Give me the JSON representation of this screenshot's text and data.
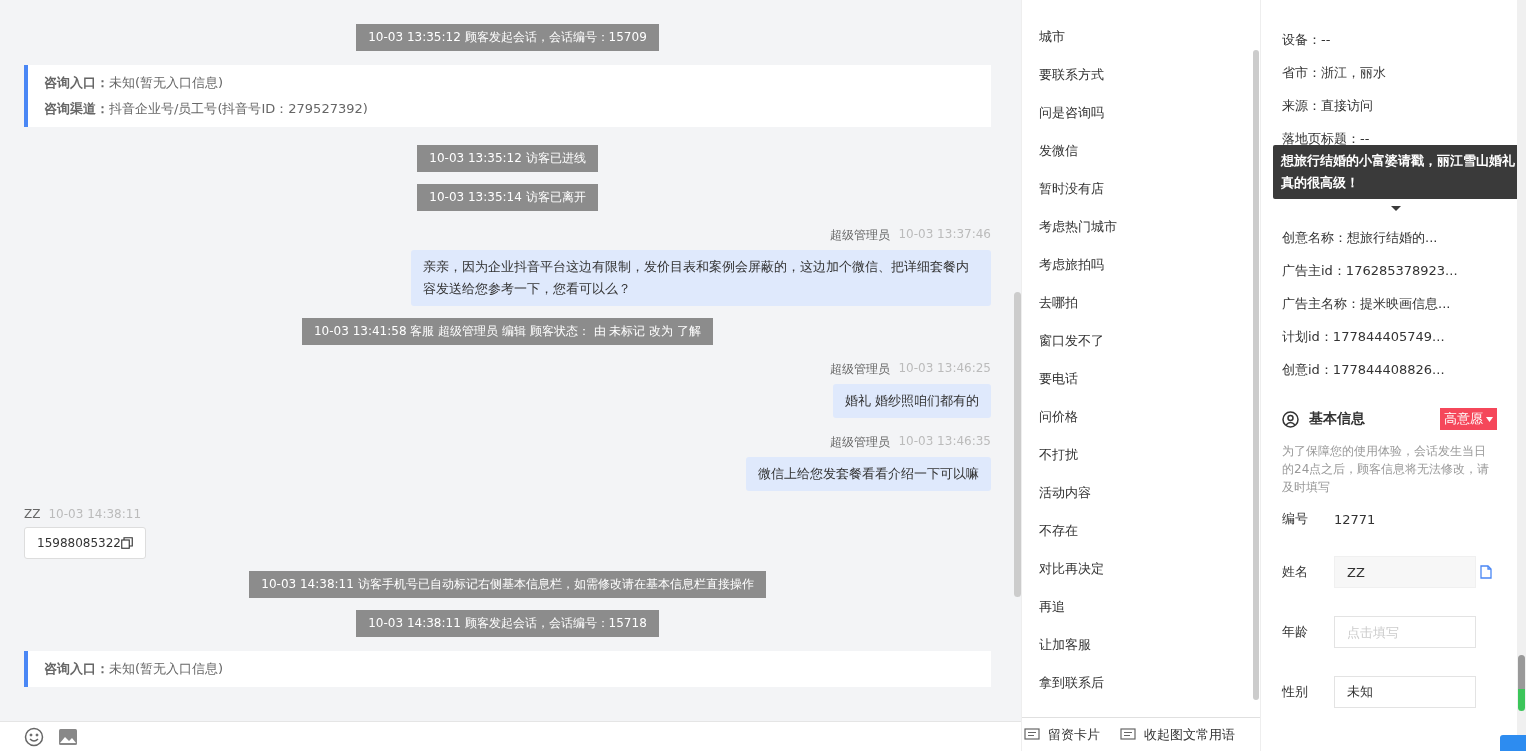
{
  "chat": {
    "messages": [
      {
        "kind": "system",
        "text": "10-03 13:35:12 顾客发起会话，会话编号：15709"
      },
      {
        "kind": "info",
        "lines": [
          {
            "label": "咨询入口：",
            "value": "未知(暂无入口信息)"
          },
          {
            "label": "咨询渠道：",
            "value": "抖音企业号/员工号(抖音号ID：279527392)"
          }
        ]
      },
      {
        "kind": "system",
        "text": "10-03 13:35:12 访客已进线"
      },
      {
        "kind": "system",
        "text": "10-03 13:35:14 访客已离开"
      },
      {
        "kind": "agent",
        "name": "超级管理员",
        "time": "10-03 13:37:46",
        "text": "亲亲，因为企业抖音平台这边有限制，发价目表和案例会屏蔽的，这边加个微信、把详细套餐内容发送给您参考一下，您看可以么？"
      },
      {
        "kind": "system",
        "text": "10-03 13:41:58 客服 超级管理员 编辑 顾客状态： 由 未标记 改为 了解"
      },
      {
        "kind": "agent",
        "name": "超级管理员",
        "time": "10-03 13:46:25",
        "text": "婚礼  婚纱照咱们都有的"
      },
      {
        "kind": "agent",
        "name": "超级管理员",
        "time": "10-03 13:46:35",
        "text": "微信上给您发套餐看看介绍一下可以嘛"
      },
      {
        "kind": "visitor",
        "name": "ZZ",
        "time": "10-03 14:38:11",
        "text": "15988085322"
      },
      {
        "kind": "system",
        "text": "10-03 14:38:11 访客手机号已自动标记右侧基本信息栏，如需修改请在基本信息栏直接操作"
      },
      {
        "kind": "system",
        "text": "10-03 14:38:11 顾客发起会话，会话编号：15718"
      },
      {
        "kind": "info",
        "lines": [
          {
            "label": "咨询入口：",
            "value": "未知(暂无入口信息)"
          }
        ]
      }
    ]
  },
  "phrases": {
    "items": [
      "城市",
      "要联系方式",
      "问是咨询吗",
      "发微信",
      "暂时没有店",
      "考虑热门城市",
      "考虑旅拍吗",
      "去哪拍",
      "窗口发不了",
      "要电话",
      "问价格",
      "不打扰",
      "活动内容",
      "不存在",
      "对比再决定",
      "再追",
      "让加客服",
      "拿到联系后"
    ],
    "footer": [
      "留资卡片",
      "收起图文常用语"
    ]
  },
  "visit_info": {
    "rows_before": [
      "设备：--",
      "省市：浙江，丽水",
      "来源：直接访问",
      "落地页标题：--"
    ],
    "tooltip": "想旅行结婚的小富婆请戳，丽江雪山婚礼真的很高级！",
    "rows_after": [
      "创意名称：想旅行结婚的...",
      "广告主id：176285378923...",
      "广告主名称：提米映画信息...",
      "计划id：177844405749...",
      "创意id：177844408826..."
    ]
  },
  "basic_info": {
    "title": "基本信息",
    "tag": "高意愿",
    "note": "为了保障您的使用体验，会话发生当日的24点之后，顾客信息将无法修改，请及时填写",
    "fields": [
      {
        "kind": "text",
        "label": "编号",
        "value": "12771"
      },
      {
        "kind": "input",
        "label": "姓名",
        "value": "ZZ",
        "disabled": true,
        "copy": true
      },
      {
        "kind": "input",
        "label": "年龄",
        "placeholder": "点击填写",
        "disabled": false,
        "copy": false
      },
      {
        "kind": "input",
        "label": "性别",
        "value": "未知",
        "disabled": false,
        "copy": false
      }
    ]
  }
}
